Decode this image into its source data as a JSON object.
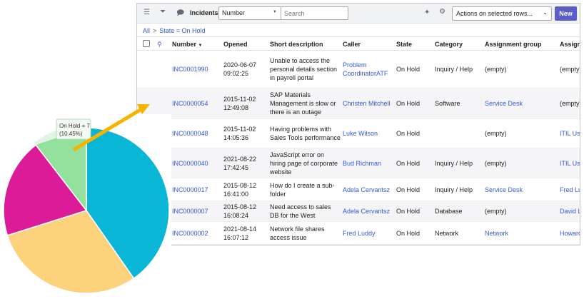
{
  "header": {
    "title": "Incidents",
    "field_select": "Number",
    "search_placeholder": "Search",
    "actions_select": "Actions on selected rows...",
    "new_label": "New"
  },
  "breadcrumb": [
    "All",
    ">",
    "State = On Hold"
  ],
  "columns": [
    "Number",
    "Opened",
    "Short description",
    "Caller",
    "State",
    "Category",
    "Assignment group",
    "Assigne"
  ],
  "rows": [
    {
      "number": "INC0001990",
      "opened": "2020-06-07 09:02:25",
      "desc": "Unable to access the personal details section in payroll portal",
      "caller": "Problem CoordinatorATF",
      "state": "On Hold",
      "category": "Inquiry / Help",
      "group": "(empty)",
      "assignee": "(empty)"
    },
    {
      "number": "INC0000054",
      "opened": "2015-11-02 12:49:08",
      "desc": "SAP Materials Management is slow or there is an outage",
      "caller": "Christen Mitchell",
      "state": "On Hold",
      "category": "Software",
      "group": "Service Desk",
      "assignee": "(empty)"
    },
    {
      "number": "INC0000048",
      "opened": "2015-11-02 14:05:36",
      "desc": "Having problems with Sales Tools performance",
      "caller": "Luke Wilson",
      "state": "On Hold",
      "category": "",
      "group": "(empty)",
      "assignee": "ITIL Use"
    },
    {
      "number": "INC0000040",
      "opened": "2021-08-22 17:42:45",
      "desc": "JavaScript error on hiring page of corporate website",
      "caller": "Bud Richman",
      "state": "On Hold",
      "category": "Inquiry / Help",
      "group": "(empty)",
      "assignee": "ITIL Use"
    },
    {
      "number": "INC0000017",
      "opened": "2015-08-12 16:41:00",
      "desc": "How do I create a sub-folder",
      "caller": "Adela Cervantsz",
      "state": "On Hold",
      "category": "Inquiry / Help",
      "group": "Service Desk",
      "assignee": "Fred Lu"
    },
    {
      "number": "INC0000007",
      "opened": "2015-08-12 16:08:24",
      "desc": "Need access to sales DB for the West",
      "caller": "Adela Cervantsz",
      "state": "On Hold",
      "category": "Database",
      "group": "(empty)",
      "assignee": "David L"
    },
    {
      "number": "INC0000002",
      "opened": "2021-08-14 16:07:12",
      "desc": "Network file shares access issue",
      "caller": "Fred Luddy",
      "state": "On Hold",
      "category": "Network",
      "group": "Network",
      "assignee": "Howard"
    }
  ],
  "chart_data": {
    "type": "pie",
    "slices": [
      {
        "label": "",
        "value": 27,
        "color": "#0ab6d6"
      },
      {
        "label": "",
        "value": 20,
        "color": "#fdd27c"
      },
      {
        "label": "",
        "value": 13,
        "color": "#db1b98"
      },
      {
        "label": "On Hold",
        "value": 7,
        "color": "#93e19c"
      }
    ],
    "tooltip": {
      "line1": "On Hold = 7",
      "line2": "(10.45%)"
    }
  },
  "annotation_color": "#f6b400"
}
